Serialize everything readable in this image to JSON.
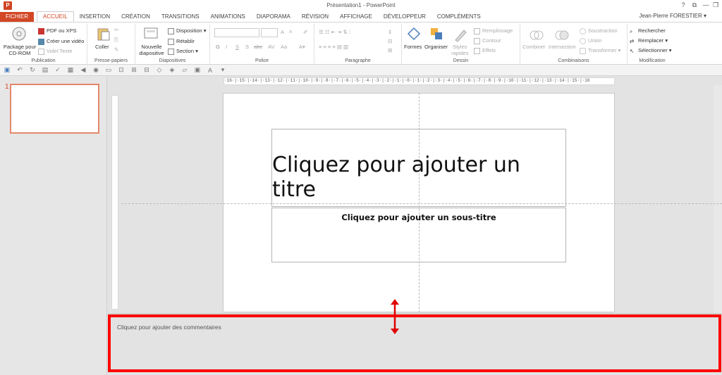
{
  "window": {
    "title": "Présentation1 - PowerPoint",
    "app_icon_letter": "P",
    "help": "?",
    "ribbon_toggle": "⧉",
    "minimize": "—",
    "restore": "❐",
    "close": "✕",
    "user": "Jean-Pierre FORESTIER ▾"
  },
  "tabs": [
    "FICHIER",
    "ACCUEIL",
    "INSERTION",
    "CRÉATION",
    "TRANSITIONS",
    "ANIMATIONS",
    "DIAPORAMA",
    "RÉVISION",
    "AFFICHAGE",
    "DÉVELOPPEUR",
    "COMPLÉMENTS"
  ],
  "ribbon": {
    "publication": {
      "label": "Publication",
      "package_line1": "Package pour",
      "package_line2": "CD-ROM",
      "pdf": "PDF ou XPS",
      "video": "Créer une vidéo",
      "voice": "Volet Texte"
    },
    "clipboard": {
      "label": "Presse-papiers",
      "paste": "Coller"
    },
    "slides": {
      "label": "Diapositives",
      "new_line1": "Nouvelle",
      "new_line2": "diapositive",
      "layout": "Disposition",
      "reset": "Rétablir",
      "section": "Section"
    },
    "font": {
      "label": "Police",
      "bold": "G",
      "italic": "I",
      "underline": "S",
      "shadow": "S",
      "strike": "abc",
      "spacing": "AV",
      "case": "Aa",
      "grow": "A",
      "shrink": "A"
    },
    "paragraph": {
      "label": "Paragraphe"
    },
    "drawing": {
      "label": "Dessin",
      "shapes": "Formes",
      "arrange": "Organiser",
      "styles_line1": "Styles",
      "styles_line2": "rapides",
      "fill": "Remplissage",
      "outline": "Contour",
      "effects": "Effets"
    },
    "combinations": {
      "label": "Combinaisons",
      "combine": "Combiner",
      "intersect": "Intersection",
      "subtract": "Soustraction",
      "union": "Union",
      "transform": "Transformer"
    },
    "editing": {
      "label": "Modification",
      "find": "Rechercher",
      "replace": "Remplacer",
      "select": "Sélectionner"
    }
  },
  "thumbnails": {
    "slide_number": "1"
  },
  "ruler": {
    "horizontal": "·16·|·15·|·14·|·13·|·12·|·11·|·10·|·9·|·8·|·7·|·6·|·5·|·4·|·3·|·2·|·1·|·0·|·1·|·2·|·3·|·4·|·5·|·6·|·7·|·8·|·9·|·10·|·11·|·12·|·13·|·14·|·15·|·16"
  },
  "slide": {
    "title_placeholder": "Cliquez pour ajouter un titre",
    "subtitle_placeholder": "Cliquez pour ajouter un sous-titre"
  },
  "notes": {
    "placeholder": "Cliquez pour ajouter des commentaires"
  },
  "colors": {
    "accent": "#d24726",
    "highlight": "#ff0000"
  }
}
